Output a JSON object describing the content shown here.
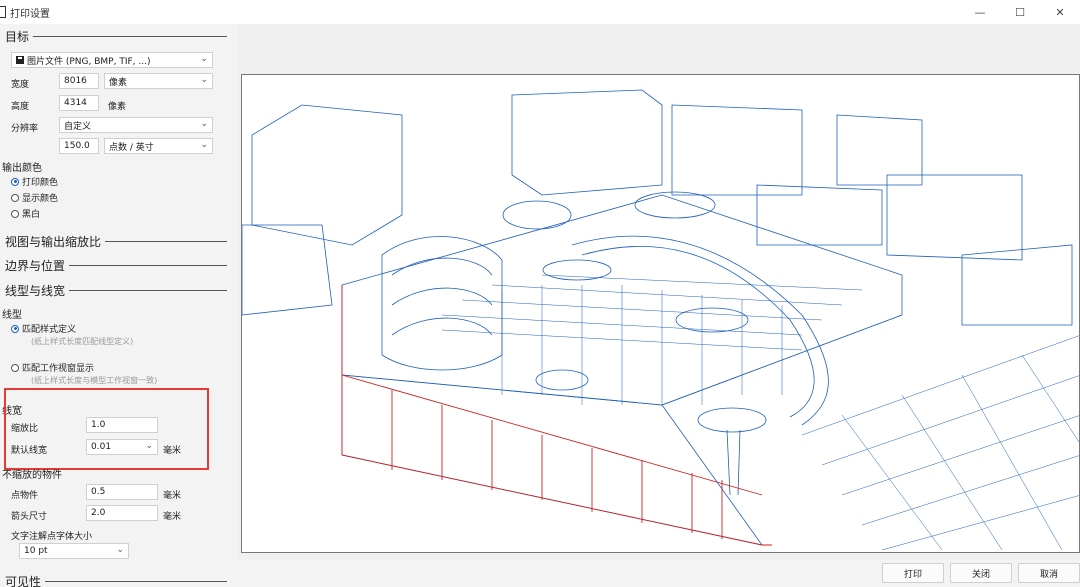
{
  "window": {
    "title": "打印设置",
    "minimize_icon": "—",
    "maximize_icon": "☐",
    "close_icon": "✕"
  },
  "panel": {
    "target_header": "目标",
    "file_type": "图片文件 (PNG, BMP, TIF, ...)",
    "width_label": "宽度",
    "width_value": "8016",
    "width_unit": "像素",
    "height_label": "高度",
    "height_value": "4314",
    "height_unit": "像素",
    "resolution_label": "分辨率",
    "resolution_value": "自定义",
    "dpi_value": "150.0",
    "dpi_unit": "点数 / 英寸",
    "output_color_header": "输出颜色",
    "color_options": [
      {
        "label": "打印颜色",
        "selected": true
      },
      {
        "label": "显示颜色",
        "selected": false
      },
      {
        "label": "黑白",
        "selected": false
      }
    ],
    "view_scale_header": "视图与输出缩放比",
    "margins_header": "边界与位置",
    "linetype_header": "线型与线宽",
    "linetype_label": "线型",
    "match_style_label": "匹配样式定义",
    "match_style_note": "(纸上样式长度匹配线型定义)",
    "match_viewport_label": "匹配工作视窗显示",
    "match_viewport_note": "(纸上样式长度与模型工作视窗一致)",
    "lineweight_label": "线宽",
    "scale_label": "缩放比",
    "scale_value": "1.0",
    "default_lw_label": "默认线宽",
    "default_lw_value": "0.01",
    "default_lw_unit": "毫米",
    "unscaled_label": "不缩放的物件",
    "point_label": "点物件",
    "point_value": "0.5",
    "point_unit": "毫米",
    "arrow_label": "箭头尺寸",
    "arrow_value": "2.0",
    "arrow_unit": "毫米",
    "text_label": "文字注解点字体大小",
    "text_value": "10 pt",
    "visibility_header": "可见性"
  },
  "buttons": {
    "print": "打印",
    "close": "关闭",
    "cancel": "取消"
  },
  "colors": {
    "accent_red": "#e53935",
    "line_blue": "#1f5fbf",
    "section_red": "#cc2222"
  }
}
